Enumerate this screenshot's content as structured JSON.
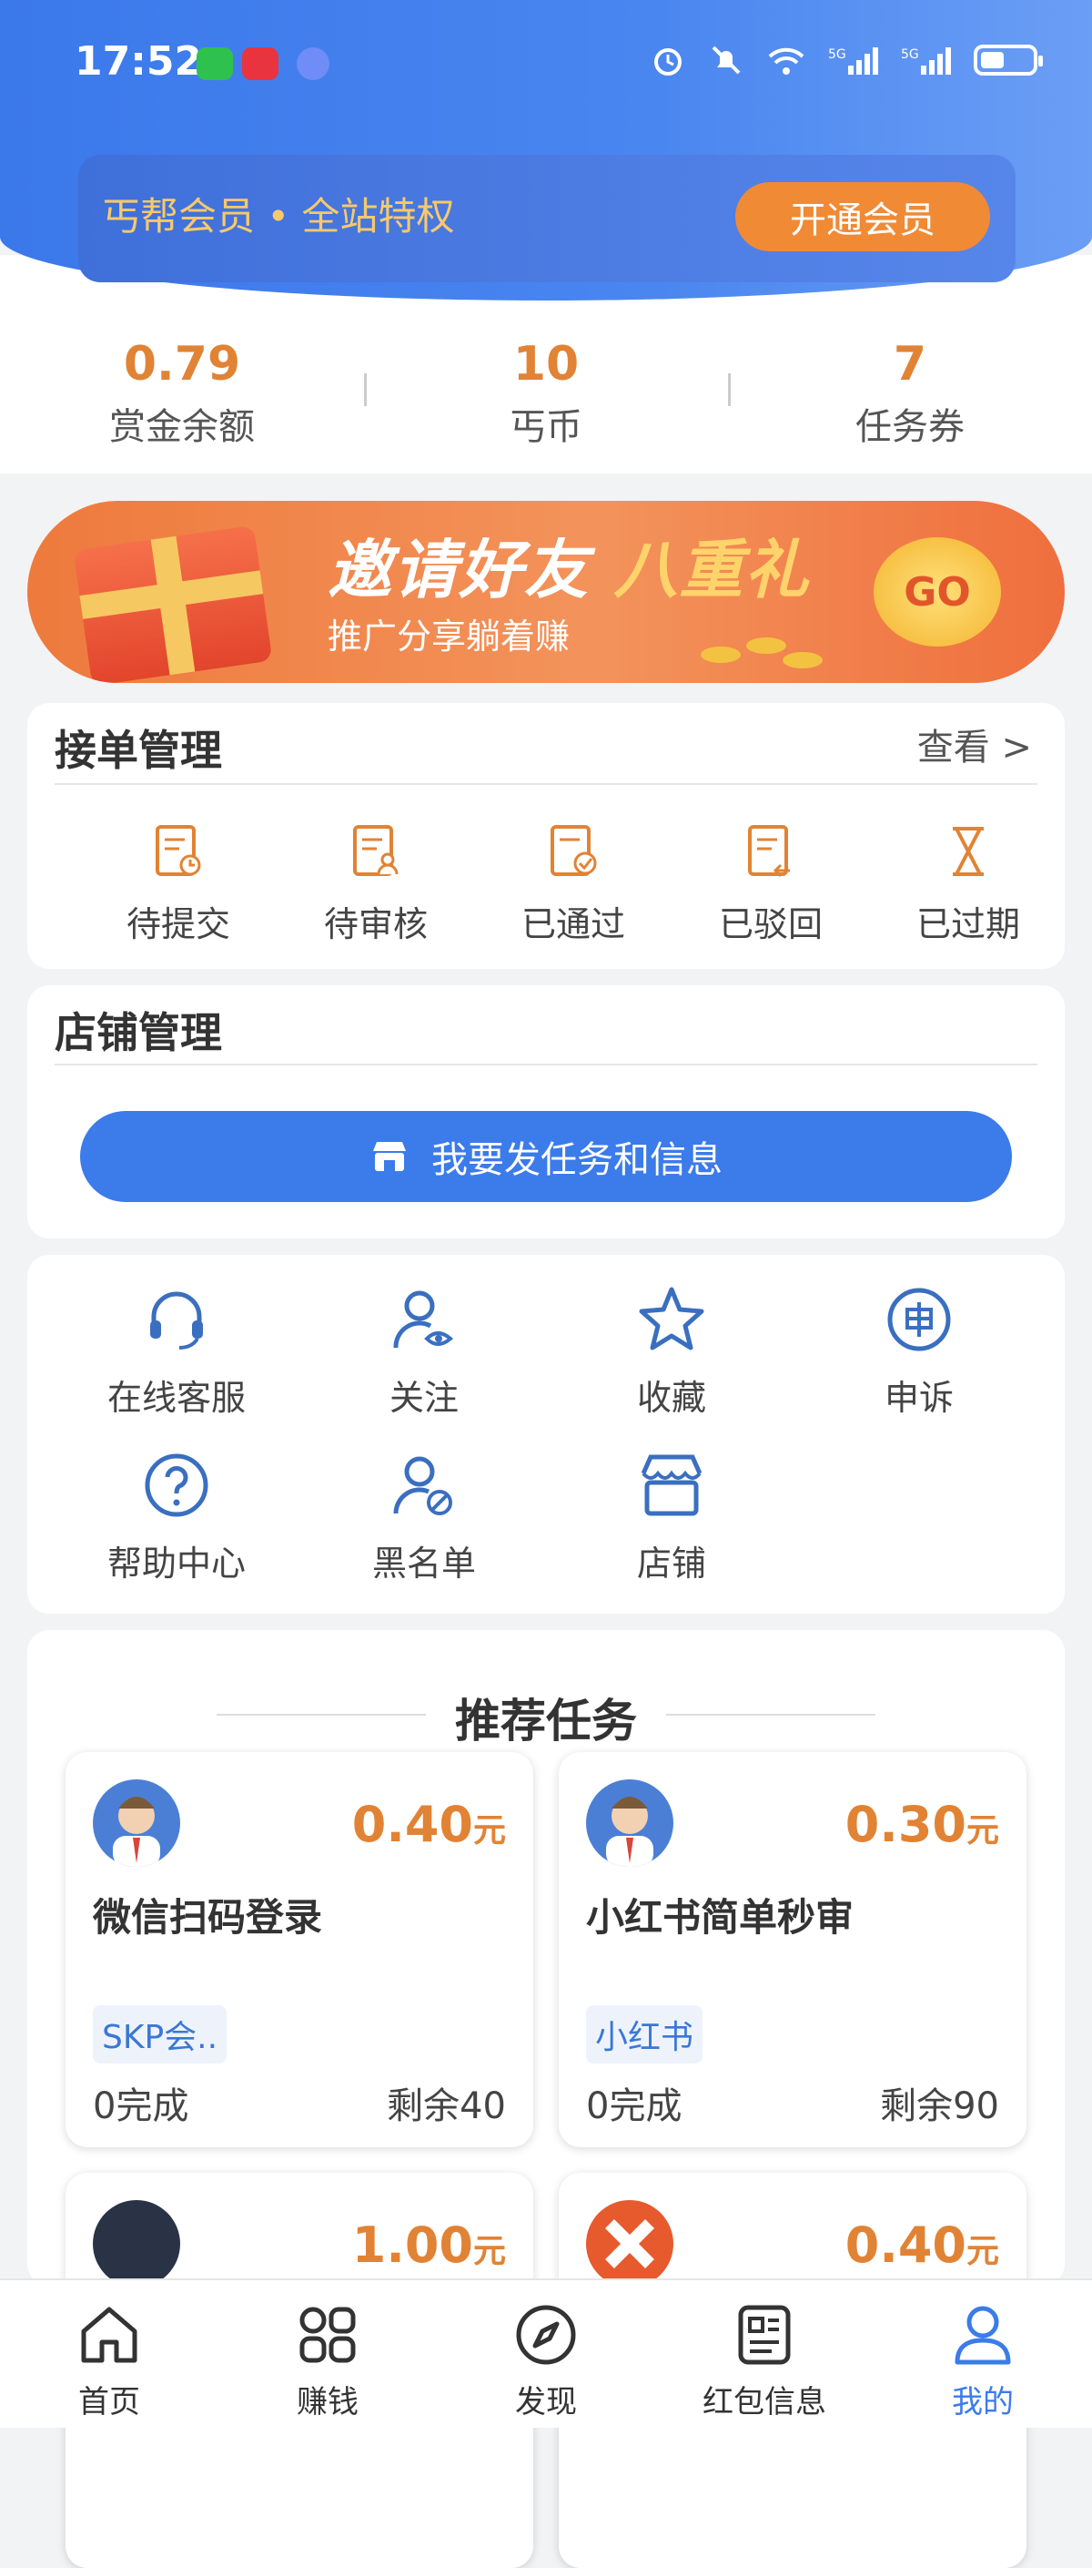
{
  "status_bar": {
    "time": "17:52"
  },
  "member": {
    "text": "丐帮会员 • 全站特权",
    "button": "开通会员"
  },
  "stats": [
    {
      "value": "0.79",
      "label": "赏金余额"
    },
    {
      "value": "10",
      "label": "丐币"
    },
    {
      "value": "7",
      "label": "任务券"
    }
  ],
  "banner": {
    "title_a": "邀请好友",
    "title_b": "八重礼",
    "subtitle": "推广分享躺着赚",
    "go": "GO"
  },
  "orders": {
    "title": "接单管理",
    "view": "查看 >",
    "items": [
      "待提交",
      "待审核",
      "已通过",
      "已驳回",
      "已过期"
    ]
  },
  "shop": {
    "title": "店铺管理",
    "publish": "我要发任务和信息"
  },
  "services": {
    "row1": [
      "在线客服",
      "关注",
      "收藏",
      "申诉"
    ],
    "row2": [
      "帮助中心",
      "黑名单",
      "店铺"
    ]
  },
  "recommend": {
    "title": "推荐任务",
    "tasks": [
      {
        "price": "0.40",
        "unit": "元",
        "name": "微信扫码登录",
        "tag": "SKP会..",
        "done": "0完成",
        "left": "剩余40"
      },
      {
        "price": "0.30",
        "unit": "元",
        "name": "小红书简单秒审",
        "tag": "小红书",
        "done": "0完成",
        "left": "剩余90"
      },
      {
        "price": "1.00",
        "unit": "元"
      },
      {
        "price": "0.40",
        "unit": "元"
      }
    ]
  },
  "tabbar": [
    "首页",
    "赚钱",
    "发现",
    "红包信息",
    "我的"
  ]
}
